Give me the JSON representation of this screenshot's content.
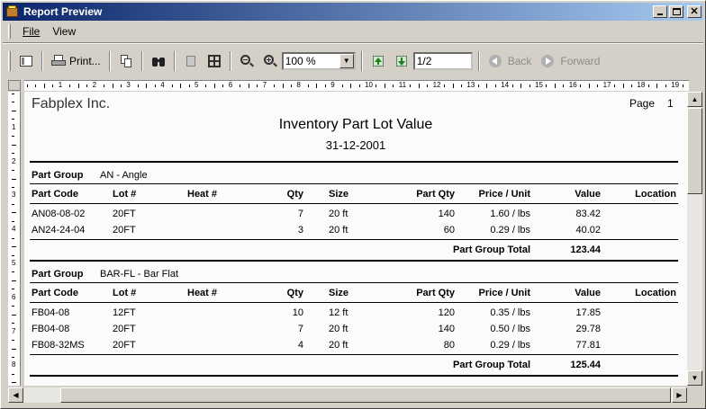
{
  "window": {
    "title": "Report Preview"
  },
  "menu": {
    "file": "File",
    "view": "View"
  },
  "toolbar": {
    "print_label": "Print...",
    "zoom_value": "100 %",
    "page_value": "1/2",
    "back_label": "Back",
    "forward_label": "Forward"
  },
  "ruler": {
    "h_numbers": [
      "1",
      "2",
      "3",
      "4",
      "5",
      "6",
      "7",
      "8",
      "9",
      "10",
      "11",
      "12",
      "13",
      "14",
      "15",
      "16",
      "17",
      "18",
      "19"
    ],
    "v_numbers": [
      "1",
      "2",
      "3",
      "4",
      "5",
      "6",
      "7",
      "8"
    ]
  },
  "report": {
    "company": "Fabplex Inc.",
    "page_label": "Page",
    "page_number": "1",
    "title": "Inventory Part Lot Value",
    "date": "31-12-2001",
    "columns": {
      "part_code": "Part Code",
      "lot": "Lot #",
      "heat": "Heat #",
      "qty": "Qty",
      "size": "Size",
      "part_qty": "Part Qty",
      "price": "Price / Unit",
      "value": "Value",
      "location": "Location"
    },
    "group_label": "Part Group",
    "group_total_label": "Part Group Total",
    "groups": [
      {
        "name": "AN - Angle",
        "rows": [
          {
            "part_code": "AN08-08-02",
            "lot": "20FT",
            "qty": "7",
            "size": "20 ft",
            "part_qty": "140",
            "price": "1.60 / lbs",
            "value": "83.42"
          },
          {
            "part_code": "AN24-24-04",
            "lot": "20FT",
            "qty": "3",
            "size": "20 ft",
            "part_qty": "60",
            "price": "0.29 / lbs",
            "value": "40.02"
          }
        ],
        "total": "123.44"
      },
      {
        "name": "BAR-FL - Bar Flat",
        "rows": [
          {
            "part_code": "FB04-08",
            "lot": "12FT",
            "qty": "10",
            "size": "12 ft",
            "part_qty": "120",
            "price": "0.35 / lbs",
            "value": "17.85"
          },
          {
            "part_code": "FB04-08",
            "lot": "20FT",
            "qty": "7",
            "size": "20 ft",
            "part_qty": "140",
            "price": "0.50 / lbs",
            "value": "29.78"
          },
          {
            "part_code": "FB08-32MS",
            "lot": "20FT",
            "qty": "4",
            "size": "20 ft",
            "part_qty": "80",
            "price": "0.29 / lbs",
            "value": "77.81"
          }
        ],
        "total": "125.44"
      }
    ]
  }
}
